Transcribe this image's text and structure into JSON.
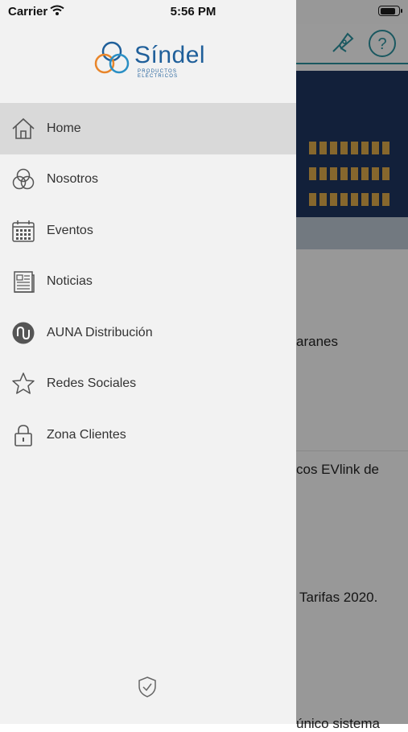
{
  "status": {
    "carrier": "Carrier",
    "time": "5:56 PM",
    "battery_level": 0.9
  },
  "drawer": {
    "logo_text": "Síndel",
    "logo_subtext": "PRODUCTOS ELÉCTRICOS",
    "items": [
      {
        "label": "Home",
        "icon": "home-icon",
        "active": true
      },
      {
        "label": "Nosotros",
        "icon": "circles-icon",
        "active": false
      },
      {
        "label": "Eventos",
        "icon": "calendar-icon",
        "active": false
      },
      {
        "label": "Noticias",
        "icon": "newspaper-icon",
        "active": false
      },
      {
        "label": "AUNA Distribución",
        "icon": "auna-icon",
        "active": false
      },
      {
        "label": "Redes Sociales",
        "icon": "star-icon",
        "active": false
      },
      {
        "label": "Zona Clientes",
        "icon": "lock-icon",
        "active": false
      }
    ]
  },
  "background": {
    "list": [
      "aranes",
      "cos EVlink de",
      "Tarifas 2020.",
      "único sistema"
    ]
  },
  "colors": {
    "accent": "#2a8f9c",
    "brand_blue": "#1f5f9a",
    "brand_orange": "#e8852a",
    "active_row": "#d9d9d9"
  }
}
